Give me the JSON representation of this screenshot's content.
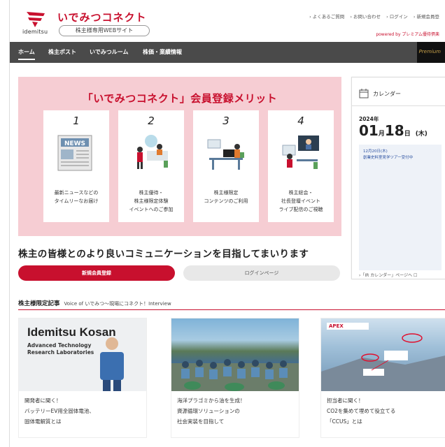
{
  "header": {
    "logo_word": "idemitsu",
    "brand": "いでみつコネクト",
    "pill": "株主様専用WEBサイト",
    "util_links": [
      "› よくあるご質問",
      "› お問い合わせ",
      "› ログイン",
      "› 新規会員登"
    ],
    "powered": "powered by プレミアム優待倶楽"
  },
  "nav": {
    "items": [
      "ホーム",
      "株主ポスト",
      "いでみつルーム",
      "株価・業績情報"
    ],
    "premium": "Premium"
  },
  "merit": {
    "title": "「いでみつコネクト」会員登録メリット",
    "cards": [
      {
        "num": "1",
        "text": "最新ニュースなどの\nタイムリーなお届け",
        "icon": "newspaper-icon",
        "news": "NEWS"
      },
      {
        "num": "2",
        "text": "株主優待・\n株主様限定体験\nイベントへのご参加",
        "icon": "event-reception-icon"
      },
      {
        "num": "3",
        "text": "株主様限定\nコンテンツのご利用",
        "icon": "desk-computer-icon"
      },
      {
        "num": "4",
        "text": "株主総会・\n社長登壇イベント\nライブ配信のご視聴",
        "icon": "live-stream-icon"
      }
    ]
  },
  "calendar": {
    "heading": "カレンダー",
    "year": "2024年",
    "month": "01",
    "month_unit": "月",
    "day": "18",
    "day_unit": "日",
    "weekday": "(木)",
    "event": "12月20日(木)\n創業史料室見学ツアー受付中",
    "link": "›「IR カレンダー」ページへ ☐"
  },
  "lead": "株主の皆様とのより良いコミュニケーションを目指してまいります",
  "buttons": {
    "register": "新規会員登録",
    "login": "ログインページ"
  },
  "section": {
    "title": "株主様限定記事",
    "subtitle": "Voice of いでみつ～現場にコネクト！Interview"
  },
  "articles": [
    {
      "text": "開発者に聞く！\nバッテリーEV用全固体電池、\n固体電解質とは",
      "img_title": "Idemitsu Kosan",
      "img_sub": "Advanced Technology\nResearch Laboratories"
    },
    {
      "text": "海洋プラゴミから油を生成！\n資源循環ソリューションの\n社会実装を目指して"
    },
    {
      "text": "担当者に聞く！\nCO2を集めて埋めて役立てる\n「CCUS」とは",
      "img_badge": "APEX"
    }
  ],
  "colors": {
    "accent": "#c8102e",
    "pink": "#f6cdd3",
    "nav": "#4a4a4a"
  }
}
